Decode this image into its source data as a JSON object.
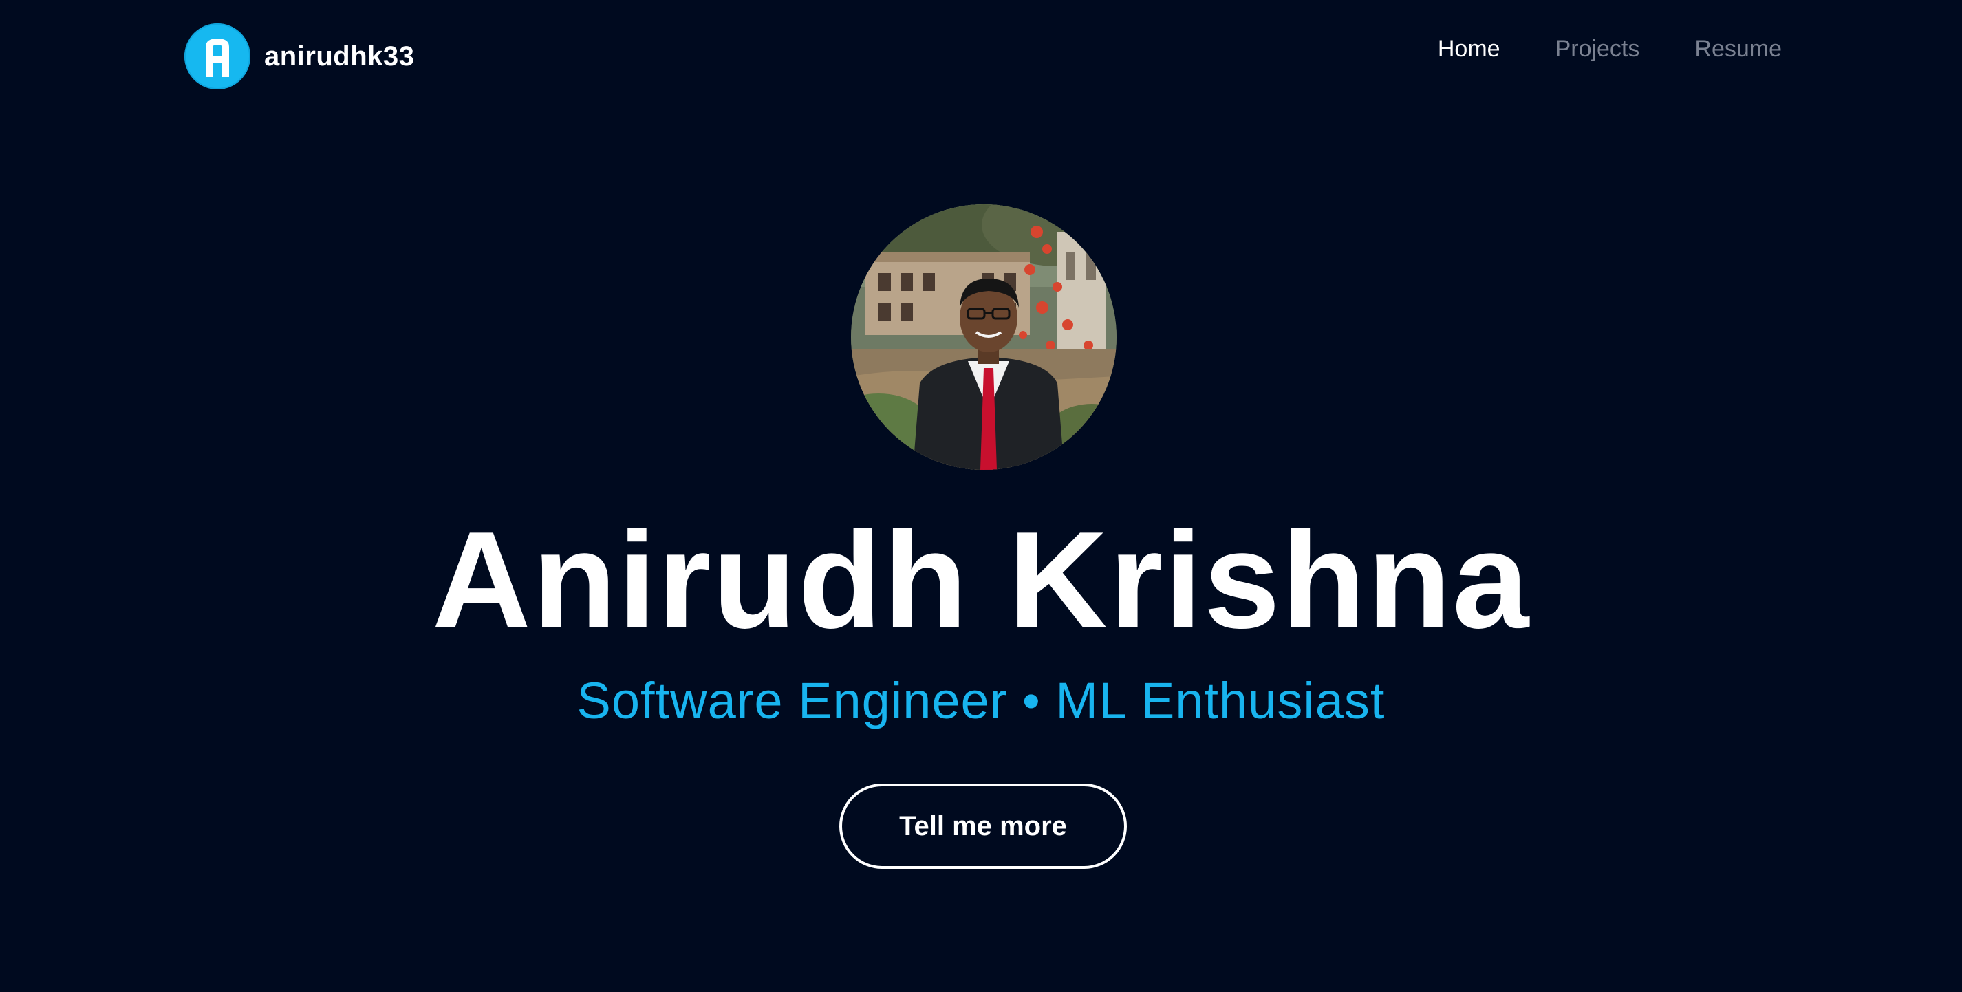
{
  "header": {
    "brand_name": "anirudhk33",
    "logo_icon": "letter-a-logo-icon",
    "nav": [
      {
        "label": "Home",
        "active": true
      },
      {
        "label": "Projects",
        "active": false
      },
      {
        "label": "Resume",
        "active": false
      }
    ]
  },
  "hero": {
    "avatar": "profile-photo",
    "name": "Anirudh Krishna",
    "subtitle": "Software Engineer • ML Enthusiast",
    "cta_label": "Tell me more"
  },
  "colors": {
    "background": "#000a1f",
    "accent": "#18b4ef",
    "text": "#ffffff",
    "nav_inactive": "#7a8191"
  }
}
